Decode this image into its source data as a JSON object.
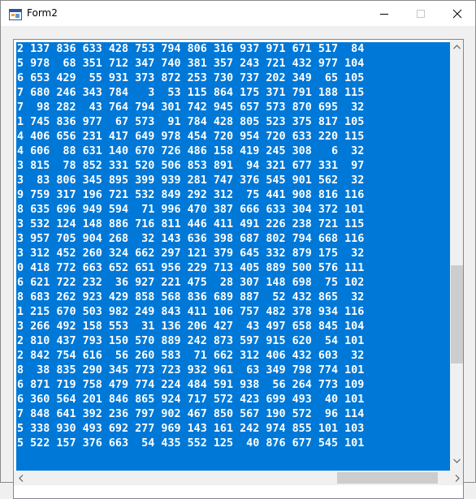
{
  "window": {
    "title": "Form2",
    "minimize_glyph": "—",
    "maximize_glyph": "☐",
    "close_glyph": "✕"
  },
  "icons": {
    "app": "form-app-icon",
    "up": "chevron-up-icon",
    "down": "chevron-down-icon",
    "left": "chevron-left-icon",
    "right": "chevron-right-icon"
  },
  "colors": {
    "selection": "#0078d7",
    "text": "#ffffff",
    "titlebar": "#ffffff",
    "client": "#f0f0f0"
  },
  "listbox": {
    "rows": [
      "2 137 836 633 428 753 794 806 316 937 971 671 517  84",
      "5 978  68 351 712 347 740 381 357 243 721 432 977 104",
      "6 653 429  55 931 373 872 253 730 737 202 349  65 105",
      "7 680 246 343 784   3  53 115 864 175 371 791 188 115",
      "7  98 282  43 764 794 301 742 945 657 573 870 695  32",
      "1 745 836 977  67 573  91 784 428 805 523 375 817 105",
      "4 406 656 231 417 649 978 454 720 954 720 633 220 115",
      "4 606  88 631 140 670 726 486 158 419 245 308   6  32",
      "3 815  78 852 331 520 506 853 891  94 321 677 331  97",
      "3  83 806 345 895 399 939 281 747 376 545 901 562  32",
      "9 759 317 196 721 532 849 292 312  75 441 908 816 116",
      "8 635 696 949 594  71 996 470 387 666 633 304 372 101",
      "3 532 124 148 886 716 811 446 411 491 226 238 721 115",
      "3 957 705 904 268  32 143 636 398 687 802 794 668 116",
      "3 312 452 260 324 662 297 121 379 645 332 879 175  32",
      "0 418 772 663 652 651 956 229 713 405 889 500 576 111",
      "6 621 722 232  36 927 221 475  28 307 148 698  75 102",
      "8 683 262 923 429 858 568 836 689 887  52 432 865  32",
      "1 215 670 503 982 249 843 411 106 757 482 378 934 116",
      "3 266 492 158 553  31 136 206 427  43 497 658 845 104",
      "2 810 437 793 150 570 889 242 873 597 915 620  54 101",
      "2 842 754 616  56 260 583  71 662 312 406 432 603  32",
      "8  38 835 290 345 773 723 932 961  63 349 798 774 101",
      "6 871 719 758 479 774 224 484 591 938  56 264 773 109",
      "6 360 564 201 846 865 924 717 572 423 699 493  40 101",
      "7 848 641 392 236 797 902 467 850 567 190 572  96 114",
      "5 338 930 493 692 277 969 143 161 242 974 855 101 103",
      "5 522 157 376 663  54 435 552 125  40 876 677 545 101"
    ]
  }
}
